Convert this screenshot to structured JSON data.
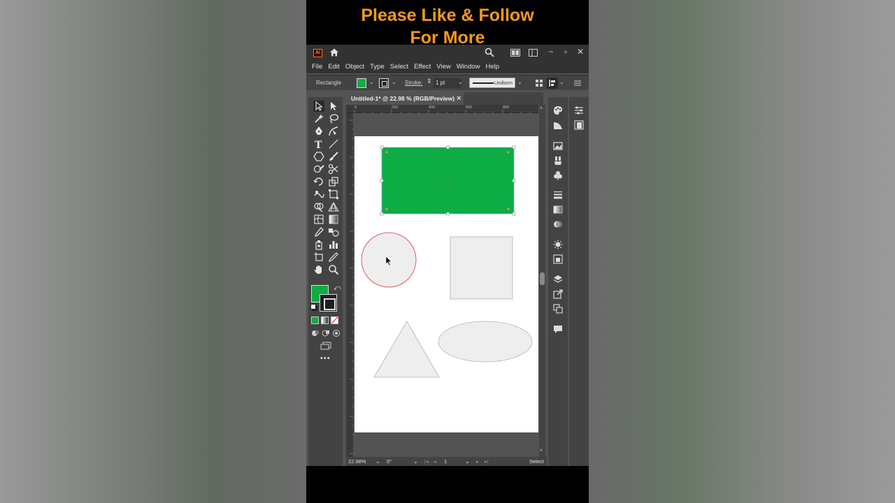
{
  "banner": {
    "line1": "Please Like & Follow",
    "line2": "For More"
  },
  "app": {
    "logo_text": "Ai"
  },
  "window_controls": {
    "minimize": "−",
    "restore": "▫",
    "close": "✕"
  },
  "menu": [
    "File",
    "Edit",
    "Object",
    "Type",
    "Select",
    "Effect",
    "View",
    "Window",
    "Help"
  ],
  "control_bar": {
    "selection_type": "Rectangle",
    "stroke_label": "Stroke:",
    "stroke_weight": "1 pt",
    "stroke_profile": "Uniform"
  },
  "document": {
    "tab_title": "Untitled-1* @ 22.98 % (RGB/Preview)",
    "close": "×"
  },
  "ruler": {
    "top_ticks": [
      "0",
      "200",
      "400",
      "600",
      "800"
    ]
  },
  "status": {
    "zoom": "22.98%",
    "rotation": "0°",
    "artboard": "1",
    "tool": "Select"
  },
  "colors": {
    "fill": "#0dac44",
    "accent_orange": "#f39a1c",
    "circle_stroke": "#d9343c",
    "shape_fill": "#eeeeee"
  },
  "toolbox": {
    "more": "•••"
  }
}
